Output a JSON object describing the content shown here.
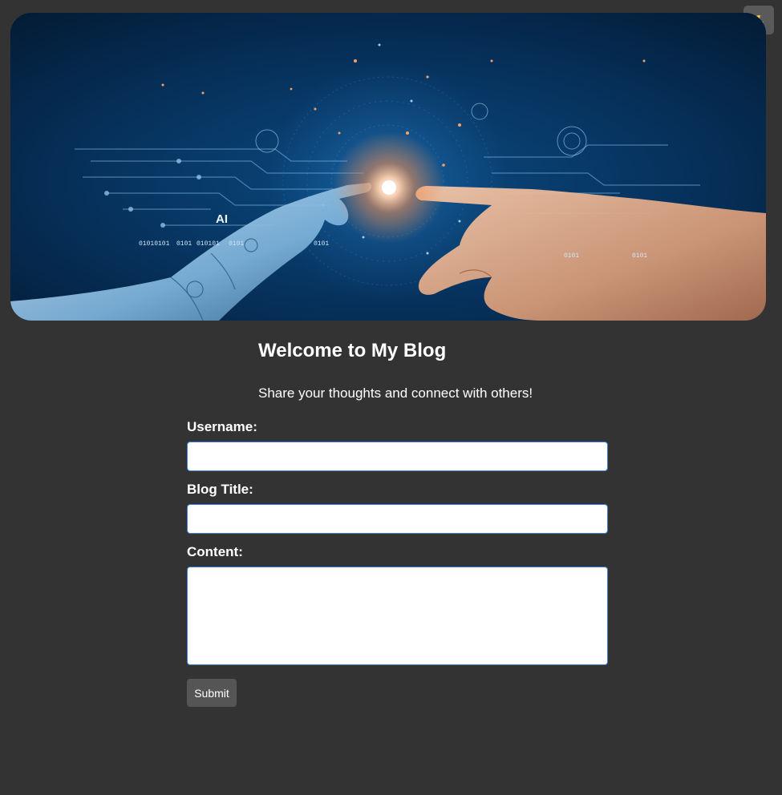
{
  "theme_toggle": {
    "icon": "moon-icon",
    "accent": "#f2c14e"
  },
  "hero": {
    "image": "robot-and-human-hands-touching",
    "texts": {
      "ai": "AI",
      "bin1": "01010101",
      "bin2": "0101",
      "bin3": "010101",
      "bin4": "0101",
      "bin5": "0101",
      "bin6": "0101",
      "bin7": "0101"
    }
  },
  "main": {
    "heading": "Welcome to My Blog",
    "subtitle": "Share your thoughts and connect with others!"
  },
  "form": {
    "username_label": "Username:",
    "username_value": "",
    "title_label": "Blog Title:",
    "title_value": "",
    "content_label": "Content:",
    "content_value": "",
    "submit_label": "Submit"
  },
  "colors": {
    "background": "#333333",
    "input_border": "#3b82d8",
    "button": "#555555"
  }
}
